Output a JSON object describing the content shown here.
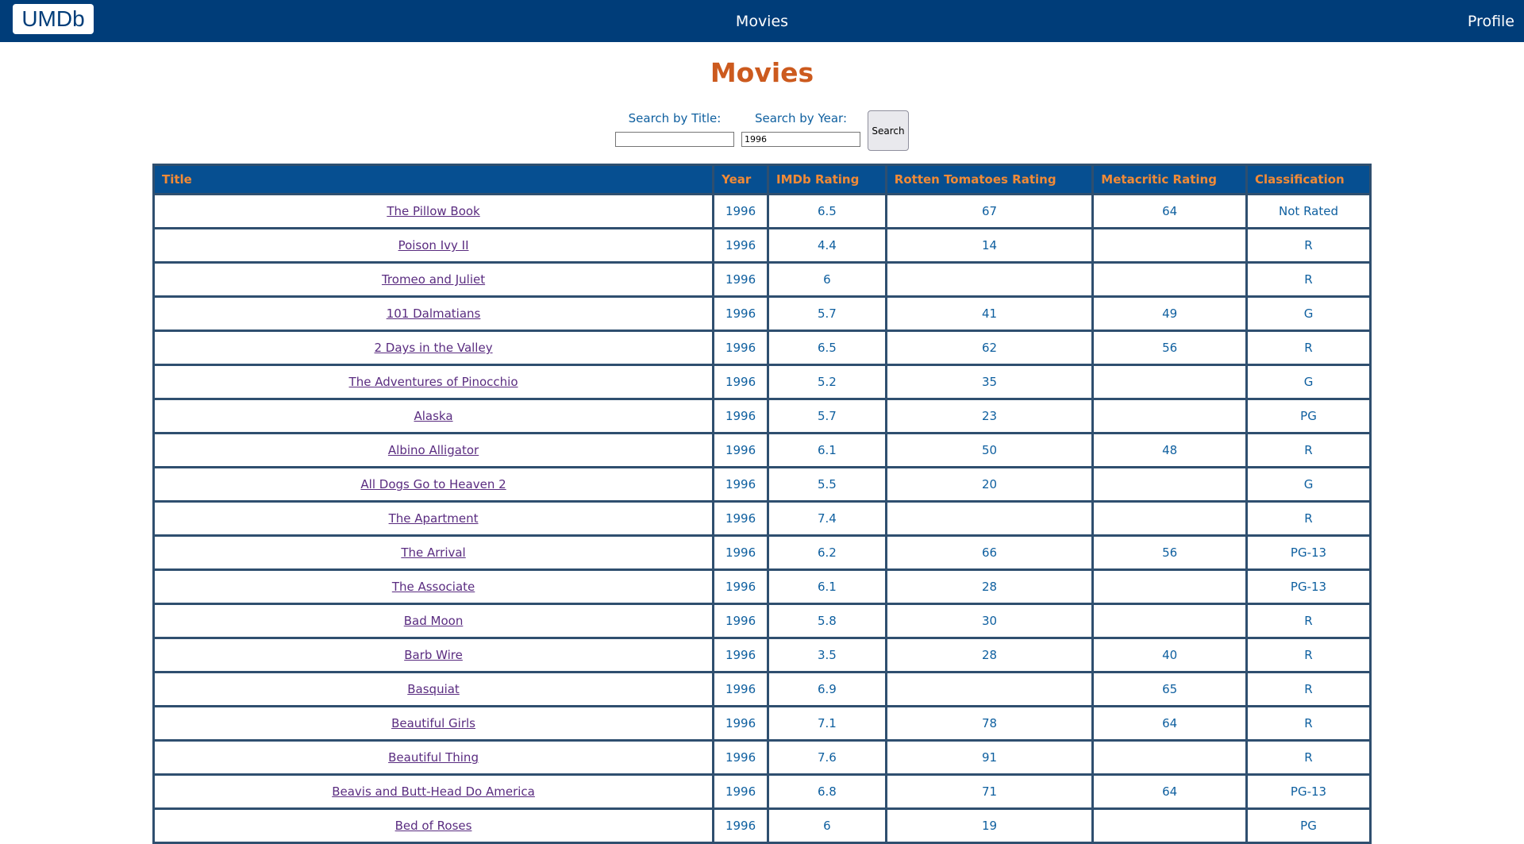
{
  "nav": {
    "logo": "UMDb",
    "center": "Movies",
    "profile": "Profile"
  },
  "page": {
    "title": "Movies"
  },
  "search": {
    "title_label": "Search by Title:",
    "title_value": "",
    "year_label": "Search by Year:",
    "year_value": "1996",
    "button": "Search"
  },
  "table": {
    "headers": [
      "Title",
      "Year",
      "IMDb Rating",
      "Rotten Tomatoes Rating",
      "Metacritic Rating",
      "Classification"
    ],
    "rows": [
      {
        "title": "The Pillow Book",
        "year": "1996",
        "imdb": "6.5",
        "rt": "67",
        "meta": "64",
        "cls": "Not Rated"
      },
      {
        "title": "Poison Ivy II",
        "year": "1996",
        "imdb": "4.4",
        "rt": "14",
        "meta": "",
        "cls": "R"
      },
      {
        "title": "Tromeo and Juliet",
        "year": "1996",
        "imdb": "6",
        "rt": "",
        "meta": "",
        "cls": "R"
      },
      {
        "title": "101 Dalmatians",
        "year": "1996",
        "imdb": "5.7",
        "rt": "41",
        "meta": "49",
        "cls": "G"
      },
      {
        "title": "2 Days in the Valley",
        "year": "1996",
        "imdb": "6.5",
        "rt": "62",
        "meta": "56",
        "cls": "R"
      },
      {
        "title": "The Adventures of Pinocchio",
        "year": "1996",
        "imdb": "5.2",
        "rt": "35",
        "meta": "",
        "cls": "G"
      },
      {
        "title": "Alaska",
        "year": "1996",
        "imdb": "5.7",
        "rt": "23",
        "meta": "",
        "cls": "PG"
      },
      {
        "title": "Albino Alligator",
        "year": "1996",
        "imdb": "6.1",
        "rt": "50",
        "meta": "48",
        "cls": "R"
      },
      {
        "title": "All Dogs Go to Heaven 2",
        "year": "1996",
        "imdb": "5.5",
        "rt": "20",
        "meta": "",
        "cls": "G"
      },
      {
        "title": "The Apartment",
        "year": "1996",
        "imdb": "7.4",
        "rt": "",
        "meta": "",
        "cls": "R"
      },
      {
        "title": "The Arrival",
        "year": "1996",
        "imdb": "6.2",
        "rt": "66",
        "meta": "56",
        "cls": "PG-13"
      },
      {
        "title": "The Associate",
        "year": "1996",
        "imdb": "6.1",
        "rt": "28",
        "meta": "",
        "cls": "PG-13"
      },
      {
        "title": "Bad Moon",
        "year": "1996",
        "imdb": "5.8",
        "rt": "30",
        "meta": "",
        "cls": "R"
      },
      {
        "title": "Barb Wire",
        "year": "1996",
        "imdb": "3.5",
        "rt": "28",
        "meta": "40",
        "cls": "R"
      },
      {
        "title": "Basquiat",
        "year": "1996",
        "imdb": "6.9",
        "rt": "",
        "meta": "65",
        "cls": "R"
      },
      {
        "title": "Beautiful Girls",
        "year": "1996",
        "imdb": "7.1",
        "rt": "78",
        "meta": "64",
        "cls": "R"
      },
      {
        "title": "Beautiful Thing",
        "year": "1996",
        "imdb": "7.6",
        "rt": "91",
        "meta": "",
        "cls": "R"
      },
      {
        "title": "Beavis and Butt-Head Do America",
        "year": "1996",
        "imdb": "6.8",
        "rt": "71",
        "meta": "64",
        "cls": "PG-13"
      },
      {
        "title": "Bed of Roses",
        "year": "1996",
        "imdb": "6",
        "rt": "19",
        "meta": "",
        "cls": "PG"
      }
    ]
  }
}
